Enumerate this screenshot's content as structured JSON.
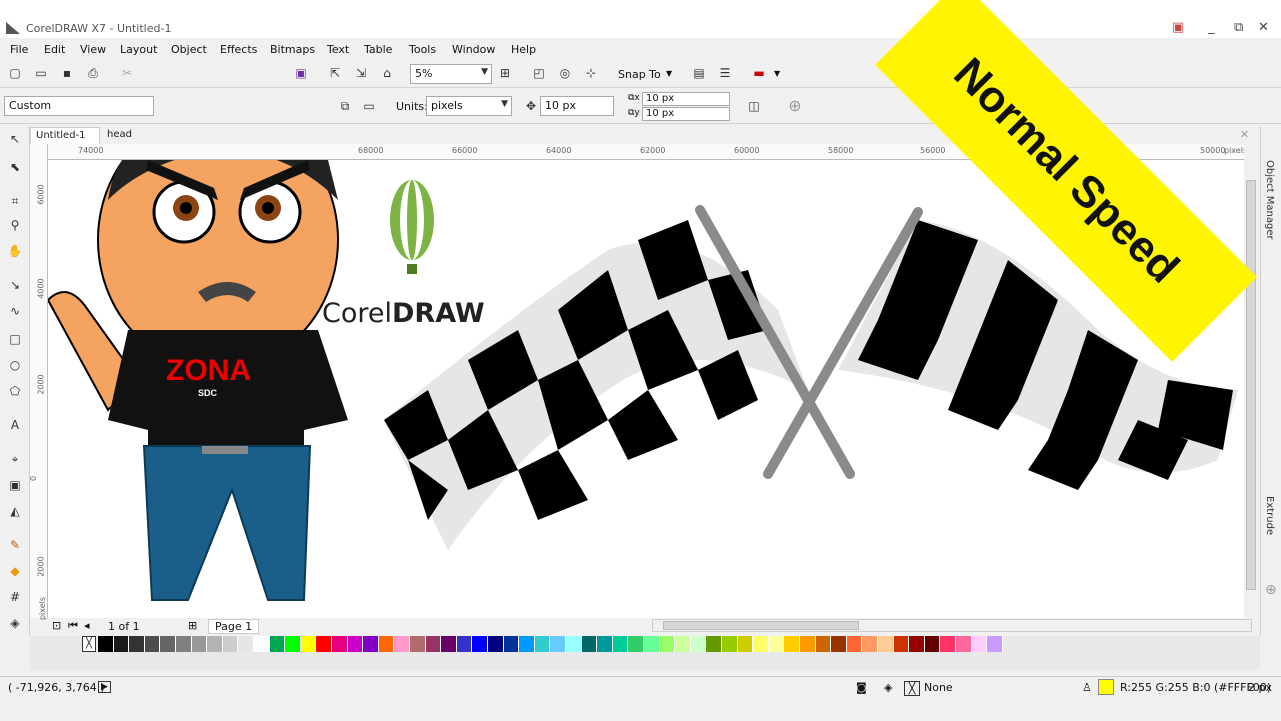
{
  "window": {
    "title": "CorelDRAW X7 - Untitled-1",
    "min": "_",
    "restore": "⧉",
    "close": "✕"
  },
  "menu": [
    "File",
    "Edit",
    "View",
    "Layout",
    "Object",
    "Effects",
    "Bitmaps",
    "Text",
    "Table",
    "Tools",
    "Window",
    "Help"
  ],
  "toolbar": {
    "zoom": "5%",
    "snap_label": "Snap To"
  },
  "property_bar": {
    "preset": "Custom",
    "units_label": "Units:",
    "units_value": "pixels",
    "nudge": "10 px",
    "dup_x": "10 px",
    "dup_y": "10 px"
  },
  "doc_tabs": [
    "Untitled-1",
    "head"
  ],
  "ruler_h": [
    "74000",
    "68000",
    "66000",
    "64000",
    "62000",
    "60000",
    "58000",
    "56000",
    "50000"
  ],
  "ruler_h_unit": "pixels",
  "ruler_v": [
    "6000",
    "4000",
    "2000",
    "0",
    "2000"
  ],
  "ruler_v_unit": "pixels",
  "dockers": [
    "Object Manager",
    "Extrude"
  ],
  "page_nav": {
    "count": "1 of 1",
    "page_label": "Page 1"
  },
  "status": {
    "coords": "( -71,926, 3,764 )",
    "fill_label": "None",
    "outline": "R:255 G:255 B:0 (#FFFF00)",
    "outline_width": "2 px",
    "fill_color": "#ffff00"
  },
  "canvas": {
    "logo_light": "Corel",
    "logo_bold": "DRAW",
    "shirt_text": "ZONA",
    "shirt_sub": "SDC"
  },
  "banner": {
    "text": "Normal Speed",
    "color": "#fff500"
  },
  "palette_colors": [
    "#000000",
    "#1a1a1a",
    "#333333",
    "#4d4d4d",
    "#666666",
    "#808080",
    "#999999",
    "#b3b3b3",
    "#cccccc",
    "#e6e6e6",
    "#ffffff",
    "#00a651",
    "#00ff00",
    "#ffff00",
    "#ff0000",
    "#e4007c",
    "#c800c8",
    "#8000c8",
    "#ff6600",
    "#ff99cc",
    "#b36b6b",
    "#993366",
    "#660066",
    "#3333cc",
    "#0000ff",
    "#000080",
    "#003399",
    "#0099ff",
    "#33cccc",
    "#66ccff",
    "#99ffff",
    "#006666",
    "#009999",
    "#00cc99",
    "#33cc66",
    "#66ff99",
    "#99ff66",
    "#ccff99",
    "#ccffcc",
    "#669900",
    "#99cc00",
    "#cccc00",
    "#ffff66",
    "#ffff99",
    "#ffcc00",
    "#ff9900",
    "#cc6600",
    "#993300",
    "#ff6633",
    "#ff9966",
    "#ffcc99",
    "#cc3300",
    "#990000",
    "#660000",
    "#ff3366",
    "#ff6699",
    "#ffccff",
    "#cc99ff"
  ]
}
